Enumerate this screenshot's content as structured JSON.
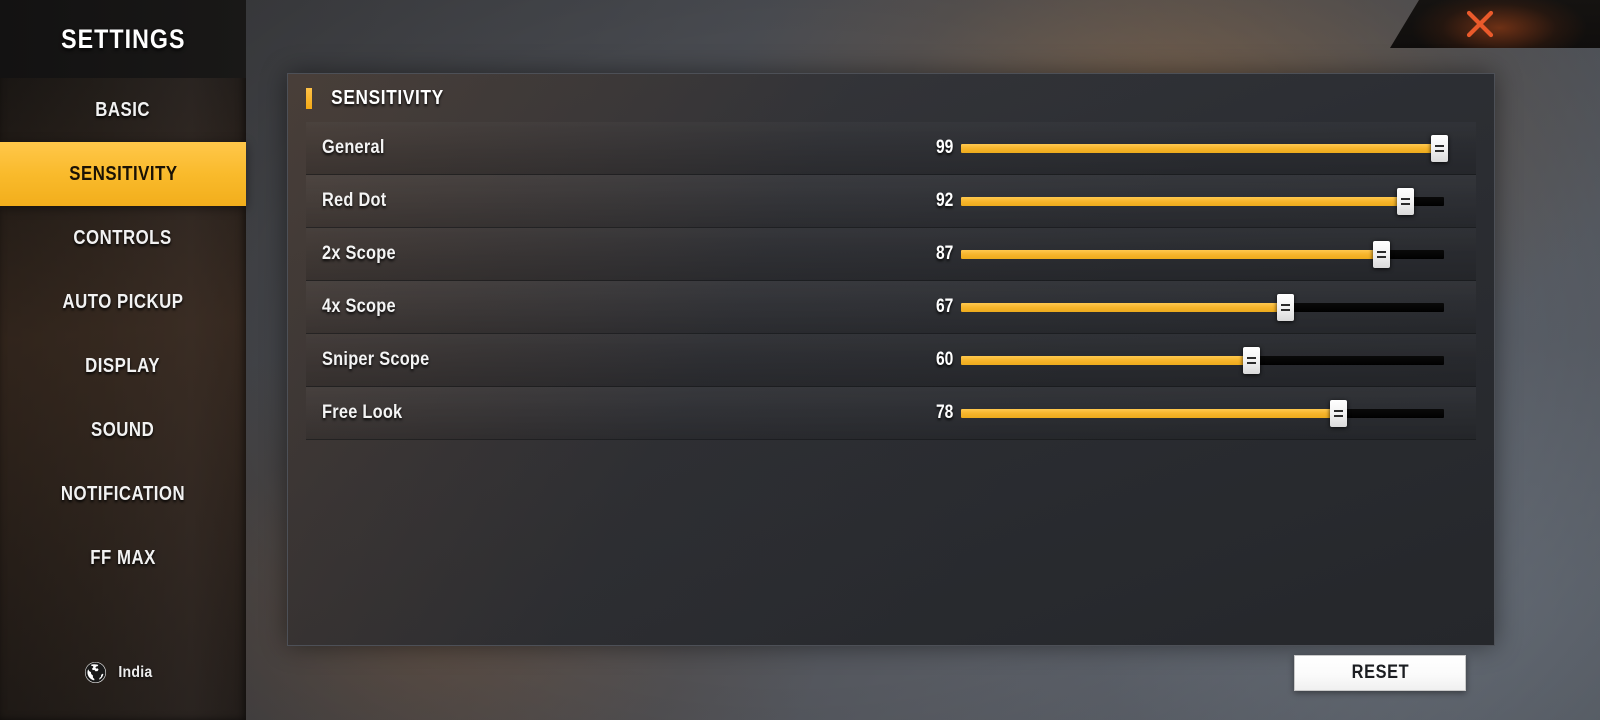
{
  "app": {
    "title": "SETTINGS"
  },
  "colors": {
    "accent": "#f9ba2b",
    "track": "#000000",
    "close": "#e8502a",
    "panel_bg": "#2c2e33",
    "sidebar_bg": "#1b1917"
  },
  "sidebar": {
    "title": "SETTINGS",
    "items": [
      {
        "label": "BASIC",
        "active": false
      },
      {
        "label": "SENSITIVITY",
        "active": true
      },
      {
        "label": "CONTROLS",
        "active": false
      },
      {
        "label": "AUTO PICKUP",
        "active": false
      },
      {
        "label": "DISPLAY",
        "active": false
      },
      {
        "label": "SOUND",
        "active": false
      },
      {
        "label": "NOTIFICATION",
        "active": false
      },
      {
        "label": "FF MAX",
        "active": false
      }
    ],
    "locale": {
      "icon": "globe-icon",
      "label": "India"
    }
  },
  "titlebar": {
    "close_icon": "close-icon"
  },
  "main": {
    "section_title": "SENSITIVITY",
    "slider_min": 0,
    "slider_max": 100,
    "rows": [
      {
        "label": "General",
        "value": "99",
        "percent": 99
      },
      {
        "label": "Red Dot",
        "value": "92",
        "percent": 92
      },
      {
        "label": "2x Scope",
        "value": "87",
        "percent": 87
      },
      {
        "label": "4x Scope",
        "value": "67",
        "percent": 67
      },
      {
        "label": "Sniper Scope",
        "value": "60",
        "percent": 60
      },
      {
        "label": "Free Look",
        "value": "78",
        "percent": 78
      }
    ]
  },
  "footer": {
    "reset_label": "RESET"
  }
}
